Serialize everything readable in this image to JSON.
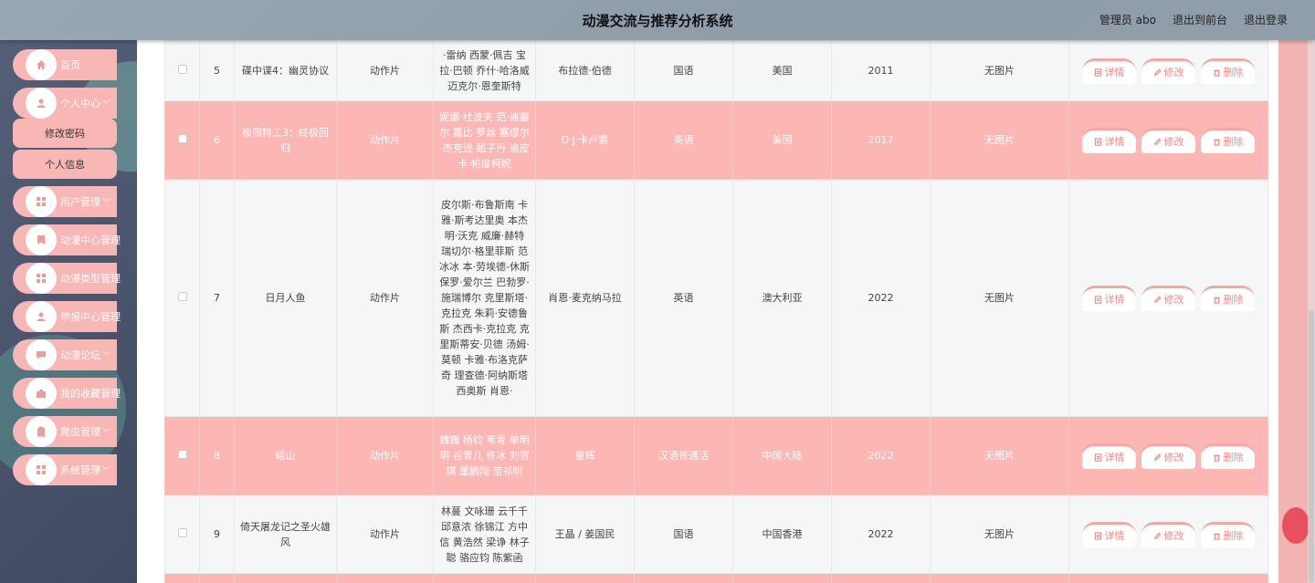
{
  "header": {
    "title": "动漫交流与推荐分析系统",
    "admin": "管理员 abo",
    "to_front": "退出到前台",
    "logout": "退出登录"
  },
  "sidebar": {
    "home": "首页",
    "personal": "个人中心",
    "change_password": "修改密码",
    "personal_info": "个人信息",
    "user_mgmt": "用户管理",
    "anime_center": "动漫中心管理",
    "anime_type": "动漫类型管理",
    "report_center": "举报中心管理",
    "forum": "动漫论坛",
    "favorites": "我的收藏管理",
    "crawler": "爬虫管理",
    "system": "系统管理"
  },
  "buttons": {
    "detail": "详情",
    "edit": "修改",
    "delete": "删除"
  },
  "rows": [
    {
      "no": "5",
      "title": "碟中谍4：幽灵协议",
      "type": "动作片",
      "cast": "·雷纳 西蒙·佩吉 宝拉·巴顿 乔什·哈洛威 迈克尔·恩奎斯特",
      "director": "布拉德·伯德",
      "language": "国语",
      "region": "美国",
      "year": "2011",
      "image": "无图片"
    },
    {
      "no": "6",
      "title": "极限特工3：终极回归",
      "type": "动作片",
      "cast": "妮娜·杜波夫 范·迪塞尔 露比·罗丝 塞缪尔·杰克逊 甄子丹 迪皮卡·帕度柯妮",
      "director": "D·J·卡卢索",
      "language": "英语",
      "region": "美国",
      "year": "2017",
      "image": "无图片"
    },
    {
      "no": "7",
      "title": "日月人鱼",
      "type": "动作片",
      "cast": "皮尔斯·布鲁斯南 卡雅·斯考达里奥 本杰明·沃克 威廉·赫特 瑞切尔·格里菲斯 范冰冰 本·劳埃德-休斯 保罗·爱尔兰 巴勃罗·施瑞博尔 克里斯塔·克拉克 朱莉·安德鲁斯 杰西卡·克拉克 克里斯蒂安·贝德 汤姆·莫顿 卡雅·布洛克萨奇 理查德·阿纳斯塔西奥斯 肖恩·",
      "director": "肖恩·麦克纳马拉",
      "language": "英语",
      "region": "澳大利亚",
      "year": "2022",
      "image": "无图片"
    },
    {
      "no": "8",
      "title": "峨山",
      "type": "动作片",
      "cast": "魏巍 杨钧 苇青 单明玥 谷雪儿 佟冰 刘官琪 董鹏翔 苗祁明",
      "director": "童辉",
      "language": "汉语普通话",
      "region": "中国大陆",
      "year": "2022",
      "image": "无图片"
    },
    {
      "no": "9",
      "title": "倚天屠龙记之圣火雄风",
      "type": "动作片",
      "cast": "林蔓 文咏珊 云千千 邱意浓 徐锦江 方中信 黄浩然 梁诤 林子聪 骆应钧 陈紫函",
      "director": "王晶 / 姜国民",
      "language": "国语",
      "region": "中国香港",
      "year": "2022",
      "image": "无图片"
    }
  ]
}
